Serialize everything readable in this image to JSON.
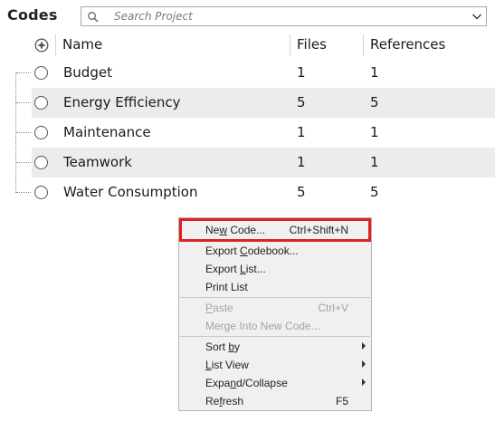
{
  "panel": {
    "title": "Codes"
  },
  "search": {
    "placeholder": "Search Project"
  },
  "columns": {
    "name": "Name",
    "files": "Files",
    "references": "References"
  },
  "rows": [
    {
      "name": "Budget",
      "files": "1",
      "references": "1"
    },
    {
      "name": "Energy Efficiency",
      "files": "5",
      "references": "5"
    },
    {
      "name": "Maintenance",
      "files": "1",
      "references": "1"
    },
    {
      "name": "Teamwork",
      "files": "1",
      "references": "1"
    },
    {
      "name": "Water Consumption",
      "files": "5",
      "references": "5"
    }
  ],
  "context_menu": {
    "items": [
      {
        "label": "New Code...",
        "mnemonic": "w",
        "shortcut": "Ctrl+Shift+N",
        "enabled": true,
        "highlighted": true
      },
      {
        "label": "Export Codebook...",
        "mnemonic": "C",
        "shortcut": "",
        "enabled": true
      },
      {
        "label": "Export List...",
        "mnemonic": "L",
        "shortcut": "",
        "enabled": true
      },
      {
        "label": "Print List",
        "mnemonic": "",
        "shortcut": "",
        "enabled": true
      },
      {
        "label": "Paste",
        "mnemonic": "P",
        "shortcut": "Ctrl+V",
        "enabled": false
      },
      {
        "label": "Merge Into New Code...",
        "mnemonic": "",
        "shortcut": "",
        "enabled": false
      },
      {
        "label": "Sort by",
        "mnemonic": "b",
        "shortcut": "",
        "enabled": true,
        "submenu": true
      },
      {
        "label": "List View",
        "mnemonic": "L",
        "shortcut": "",
        "enabled": true,
        "submenu": true
      },
      {
        "label": "Expand/Collapse",
        "mnemonic": "n",
        "shortcut": "",
        "enabled": true,
        "submenu": true
      },
      {
        "label": "Refresh",
        "mnemonic": "f",
        "shortcut": "F5",
        "enabled": true
      }
    ]
  },
  "colors": {
    "alt_row": "#ececec",
    "menu_bg": "#f0f0f0",
    "highlight_border": "#e02020",
    "disabled_text": "#a3a3a3"
  },
  "icons": {
    "search": "search-icon",
    "dropdown": "chevron-down-icon",
    "select_all": "radio-select-all-icon",
    "row_select": "radio-icon",
    "submenu": "chevron-right-icon"
  }
}
